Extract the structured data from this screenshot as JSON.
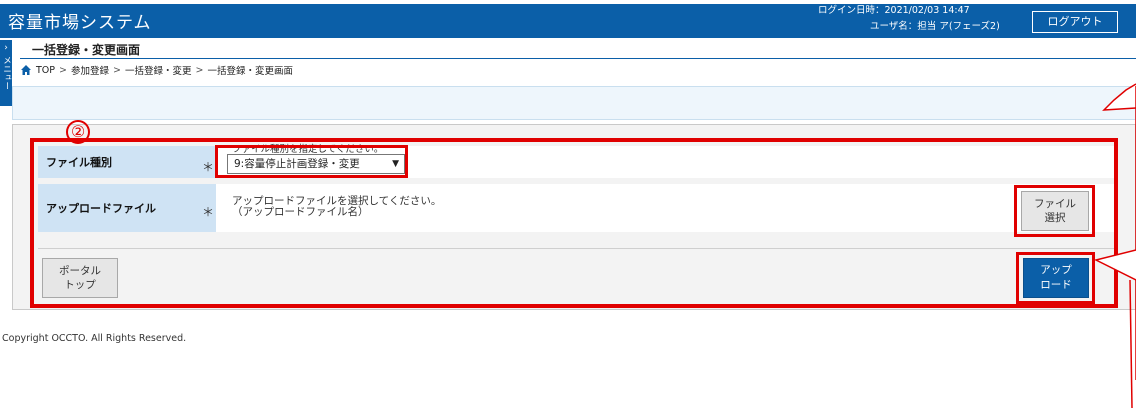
{
  "header": {
    "app_title": "容量市場システム",
    "login_datetime": "ログイン日時：2021/02/03 14:47",
    "user_name": "ユーザ名：担当 ア(フェーズ2)",
    "logout_label": "ログアウト"
  },
  "sidebar": {
    "menu_label": "メニュー"
  },
  "page": {
    "title": "一括登録・変更画面",
    "breadcrumb": [
      "TOP",
      "参加登録",
      "一括登録・変更",
      "一括登録・変更画面"
    ],
    "annotation_number": "②"
  },
  "form": {
    "file_type": {
      "label": "ファイル種別",
      "required_mark": "＊",
      "hint": "ファイル種別を指定してください。",
      "selected": "9:容量停止計画登録・変更"
    },
    "upload_file": {
      "label": "アップロードファイル",
      "required_mark": "＊",
      "hint_line1": "アップロードファイルを選択してください。",
      "hint_line2": "（アップロードファイル名）",
      "select_button_line1": "ファイル",
      "select_button_line2": "選択"
    },
    "portal_button_line1": "ポータル",
    "portal_button_line2": "トップ",
    "upload_button_line1": "アップ",
    "upload_button_line2": "ロード"
  },
  "footer": {
    "copyright": "Copyright OCCTO. All Rights Reserved."
  },
  "colors": {
    "header_blue": "#0b5fa8",
    "highlight_red": "#e00000",
    "label_bg": "#cfe3f4"
  }
}
